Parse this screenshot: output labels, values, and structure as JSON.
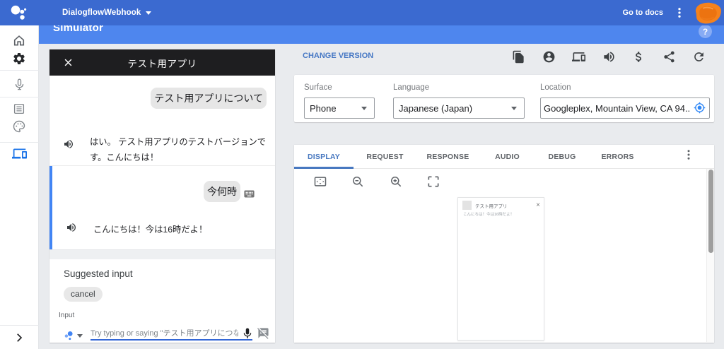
{
  "appbar": {
    "app_title": "DialogflowWebhook",
    "go_to_docs": "Go to docs",
    "icons": [
      "assistant-logo",
      "dropdown-caret",
      "more-vert-icon",
      "avatar"
    ],
    "color": "#3b6ad0"
  },
  "subheader": {
    "title": "Simulator",
    "help": "?",
    "color": "#4e86ee"
  },
  "sidebar": {
    "icons": [
      "home-icon",
      "settings-icon",
      "mic-icon",
      "article-icon",
      "palette-icon",
      "devices-icon",
      "chevron-right-icon"
    ],
    "active_icon": "devices-icon",
    "active_color": "#1a73e8"
  },
  "phone_panel": {
    "title": "テスト用アプリ",
    "close_icon": "close-icon",
    "turns": [
      {
        "user_query": "テスト用アプリについて",
        "response": "はい。 テスト用アプリのテストバージョンです。こんにちは！",
        "icons": [
          "volume-up-icon"
        ]
      },
      {
        "user_query": "今何時",
        "response": "こんにちは！今は16時だよ！",
        "icons": [
          "keyboard-icon",
          "volume-up-icon"
        ],
        "active": true,
        "active_border_color": "#4285f4"
      }
    ],
    "suggested": {
      "title": "Suggested input",
      "chips": [
        "cancel"
      ]
    },
    "input": {
      "label": "Input",
      "placeholder": "Try typing or saying \"テスト用アプリにつな",
      "value": "",
      "icons": [
        "assistant-mini-logo",
        "dropdown-caret",
        "mic-icon",
        "speaker-notes-off-icon"
      ]
    }
  },
  "controls": {
    "change_version": "CHANGE VERSION",
    "link_color": "#1a73e8",
    "action_icons": [
      "copy-icon",
      "account-circle-icon",
      "devices-icon",
      "volume-up-icon",
      "money-icon",
      "share-icon",
      "refresh-icon"
    ],
    "fields": [
      {
        "label": "Surface",
        "value": "Phone",
        "type": "select"
      },
      {
        "label": "Language",
        "value": "Japanese (Japan)",
        "type": "select"
      },
      {
        "label": "Location",
        "value": "Googleplex, Mountain View, CA 94..",
        "type": "text",
        "icon": "my-location-icon"
      }
    ]
  },
  "tabs": {
    "items": [
      {
        "label": "DISPLAY",
        "active": true
      },
      {
        "label": "REQUEST",
        "active": false
      },
      {
        "label": "RESPONSE",
        "active": false
      },
      {
        "label": "AUDIO",
        "active": false
      },
      {
        "label": "DEBUG",
        "active": false
      },
      {
        "label": "ERRORS",
        "active": false
      }
    ],
    "active_color": "#4878c0",
    "overflow_icon": "more-vert-icon",
    "toolbar_icons": [
      "fit-screen-icon",
      "zoom-out-icon",
      "zoom-in-icon",
      "crop-free-icon"
    ]
  },
  "preview": {
    "title": "テスト用アプリ",
    "close": "×",
    "message": "こんにちは！今は16時だよ！"
  }
}
